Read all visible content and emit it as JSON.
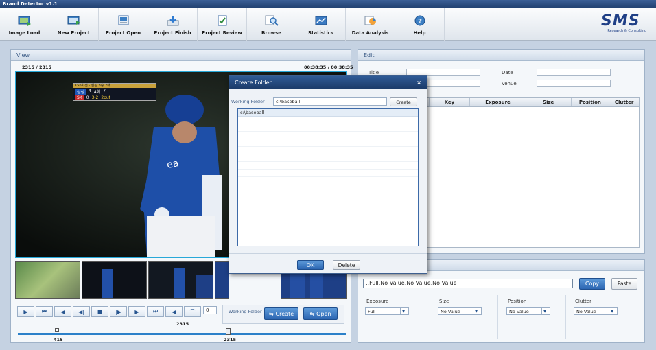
{
  "window": {
    "title": "Brand Detector v1.1"
  },
  "toolbar": {
    "items": [
      {
        "label": "Image Load",
        "icon": "image-load-icon"
      },
      {
        "label": "New Project",
        "icon": "new-project-icon"
      },
      {
        "label": "Project Open",
        "icon": "project-open-icon"
      },
      {
        "label": "Project Finish",
        "icon": "project-finish-icon"
      },
      {
        "label": "Project Review",
        "icon": "project-review-icon"
      },
      {
        "label": "Browse",
        "icon": "browse-icon"
      },
      {
        "label": "Statistics",
        "icon": "statistics-icon"
      },
      {
        "label": "Data Analysis",
        "icon": "data-analysis-icon"
      },
      {
        "label": "Help",
        "icon": "help-icon"
      }
    ],
    "logo_text": "SMS",
    "logo_sub": "Research & Consulting"
  },
  "view": {
    "header": "View",
    "frame_counter": "2315 / 2315",
    "timecode": "00:38:35 / 00:38:35",
    "thumbnails": [
      "frame-1",
      "frame-2",
      "frame-3",
      "frame-4",
      "frame-5"
    ]
  },
  "scoreboard": {
    "series": "KS6차전 - 삼성 3승 2패",
    "team1": "삼성",
    "score1": "4",
    "inning": "4회",
    "team2": "SK",
    "score2": "0",
    "count": "3-2",
    "outs": "2out",
    "pitch_no": "7"
  },
  "controls": {
    "frame_value": "0",
    "position_label": "2315",
    "working_folder_label": "Working Folder",
    "create_label": "Create",
    "open_label": "Open",
    "slider_start_label": "415",
    "slider_end_label": "2315",
    "slider_fraction": 0.99
  },
  "edit": {
    "header": "Edit",
    "title_label": "Title",
    "date_label": "Date",
    "venue_label": "Venue",
    "columns": [
      "Key",
      "Exposure",
      "Size",
      "Position",
      "Clutter"
    ]
  },
  "attr": {
    "summary_value": "..Full,No Value,No Value,No Value",
    "copy_label": "Copy",
    "paste_label": "Paste",
    "fields": [
      {
        "label": "Exposure",
        "value": "Full"
      },
      {
        "label": "Size",
        "value": "No Value"
      },
      {
        "label": "Position",
        "value": "No Value"
      },
      {
        "label": "Clutter",
        "value": "No Value"
      }
    ]
  },
  "modal": {
    "title": "Create Folder",
    "close_glyph": "×",
    "working_folder_label": "Working Folder",
    "working_folder_value": "c:\\baseball",
    "create_label": "Create",
    "list_items": [
      "c:\\baseball"
    ],
    "ok_label": "OK",
    "delete_label": "Delete"
  },
  "colors": {
    "accent": "#2c66b2",
    "video_border": "#28a8d8",
    "titlebar": "#20406f"
  }
}
